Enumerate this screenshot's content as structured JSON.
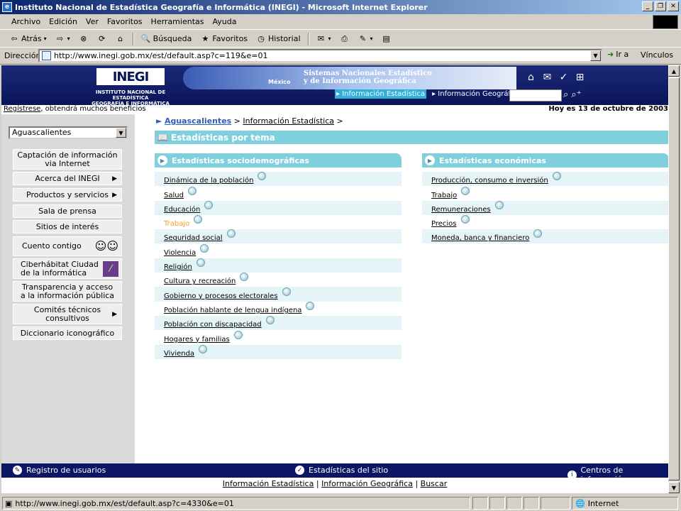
{
  "window": {
    "title": "Instituto Nacional de Estadística Geografía e Informática (INEGI) - Microsoft Internet Explorer"
  },
  "menu": [
    "Archivo",
    "Edición",
    "Ver",
    "Favoritos",
    "Herramientas",
    "Ayuda"
  ],
  "toolbar": {
    "back": "Atrás",
    "search": "Búsqueda",
    "favorites": "Favoritos",
    "history": "Historial"
  },
  "address": {
    "label": "Dirección",
    "url": "http://www.inegi.gob.mx/est/default.asp?c=119&e=01",
    "go": "Ir a",
    "links": "Vínculos"
  },
  "header": {
    "logo": "INEGI",
    "subtitle1": "INSTITUTO NACIONAL DE ESTADÍSTICA",
    "subtitle2": "GEOGRAFÍA E INFORMÁTICA",
    "banner_line1": "Sistemas Nacionales Estadístico",
    "banner_line2": "y de Información Geográfica",
    "banner_country": "México",
    "nav_stat": "Información Estadística",
    "nav_geo": "Información Geográfica"
  },
  "subheader": {
    "register": "Regístrese",
    "register_rest": ", obtendrá muchos beneficios",
    "date": "Hoy es 13 de octubre de 2003"
  },
  "state": "Aguascalientes",
  "left_menu": [
    {
      "label": "Captación de información\nvia Internet",
      "arrow": false
    },
    {
      "label": "Acerca del INEGI",
      "arrow": true
    },
    {
      "label": "Productos y servicios",
      "arrow": true
    },
    {
      "label": "Sala de prensa",
      "arrow": false
    },
    {
      "label": "Sitios de interés",
      "arrow": false
    },
    {
      "label": "Cuento contigo",
      "arrow": false
    },
    {
      "label": "Ciberhábitat Ciudad\nde la informática",
      "arrow": false
    },
    {
      "label": "Transparencia y acceso\na la información pública",
      "arrow": false
    },
    {
      "label": "Comités técnicos\nconsultivos",
      "arrow": true
    },
    {
      "label": "Diccionario iconográfico",
      "arrow": false
    }
  ],
  "breadcrumb": {
    "state": "Aguascalientes",
    "sep1": " > ",
    "section": "Información Estadística",
    "sep2": " >"
  },
  "tema_title": "Estadísticas por tema",
  "socio": {
    "title": "Estadísticas sociodemográficas",
    "items": [
      "Dinámica de la población",
      "Salud",
      "Educación",
      "Trabajo",
      "Seguridad social",
      "Violencia",
      "Religión",
      "Cultura y recreación",
      "Gobierno y procesos electorales",
      "Población hablante de lengua indígena",
      "Población con discapacidad",
      "Hogares y familias",
      "Vivienda"
    ]
  },
  "econ": {
    "title": "Estadísticas económicas",
    "items": [
      "Producción, consumo e inversión",
      "Trabajo",
      "Remuneraciones",
      "Precios",
      "Moneda, banca y financiero"
    ]
  },
  "footer": {
    "register": "Registro de usuarios",
    "stats": "Estadísticas del sitio",
    "centers": "Centros de información"
  },
  "bottom_links": {
    "a": "Información Estadística",
    "sep1": " | ",
    "b": "Información Geográfica",
    "sep2": " | ",
    "c": "Buscar"
  },
  "status": {
    "url": "http://www.inegi.gob.mx/est/default.asp?c=4330&e=01",
    "zone": "Internet"
  }
}
